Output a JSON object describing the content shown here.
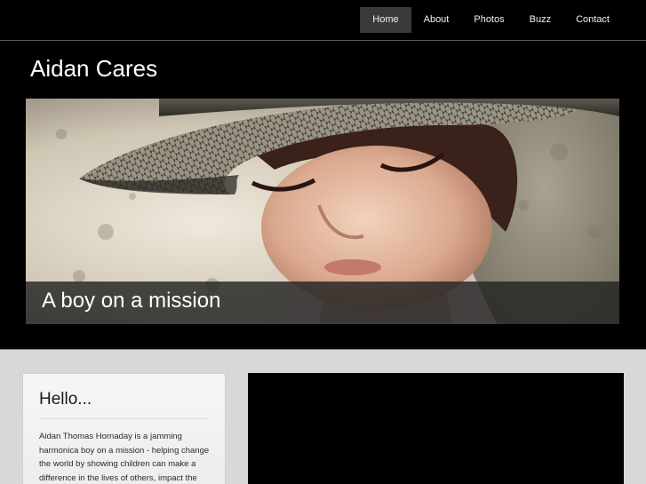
{
  "nav": {
    "items": [
      {
        "label": "Home",
        "active": true
      },
      {
        "label": "About",
        "active": false
      },
      {
        "label": "Photos",
        "active": false
      },
      {
        "label": "Buzz",
        "active": false
      },
      {
        "label": "Contact",
        "active": false
      }
    ]
  },
  "site": {
    "title": "Aidan Cares"
  },
  "hero": {
    "caption": "A boy on a mission"
  },
  "hello": {
    "heading": "Hello...",
    "text": "Aidan Thomas Hornaday is a jamming harmonica boy on a mission - helping change the world by showing children can make a difference in the lives of others, impact the"
  },
  "colors": {
    "background": "#000000",
    "nav_active": "#3a3a3a",
    "content_bg": "#d8d8d8"
  }
}
